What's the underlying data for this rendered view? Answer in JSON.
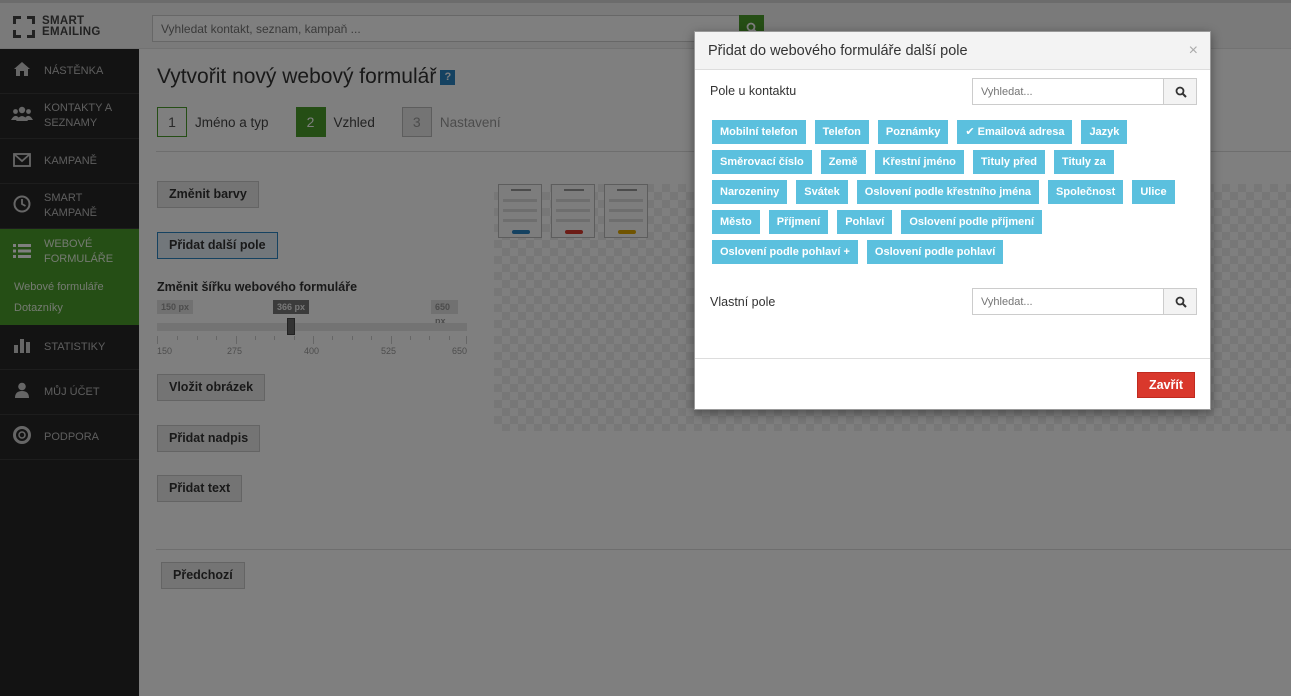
{
  "app": {
    "logo_line1": "SMART",
    "logo_line2": "EMAILING"
  },
  "top_search": {
    "placeholder": "Vyhledat kontakt, seznam, kampaň ..."
  },
  "sidebar": {
    "items": [
      {
        "label": "NÁSTĚNKA",
        "icon": "home-icon"
      },
      {
        "label": "KONTAKTY A SEZNAMY",
        "icon": "users-icon"
      },
      {
        "label": "KAMPANĚ",
        "icon": "envelope-icon"
      },
      {
        "label": "SMART KAMPANĚ",
        "icon": "clock-icon"
      },
      {
        "label": "WEBOVÉ FORMULÁŘE",
        "icon": "list-icon"
      },
      {
        "label": "STATISTIKY",
        "icon": "bar-chart-icon"
      },
      {
        "label": "MŮJ ÚČET",
        "icon": "user-icon"
      },
      {
        "label": "PODPORA",
        "icon": "lifebuoy-icon"
      }
    ],
    "sub_items": [
      "Webové formuláře",
      "Dotazníky"
    ]
  },
  "page": {
    "title": "Vytvořit nový webový formulář",
    "help": "?",
    "steps": [
      {
        "num": "1",
        "label": "Jméno a typ"
      },
      {
        "num": "2",
        "label": "Vzhled"
      },
      {
        "num": "3",
        "label": "Nastavení"
      }
    ],
    "buttons": {
      "change_colors": "Změnit barvy",
      "add_field": "Přidat další pole",
      "insert_image": "Vložit obrázek",
      "add_heading": "Přidat nadpis",
      "add_text": "Přidat text",
      "previous": "Předchozí"
    },
    "width_label": "Změnit šířku webového formuláře",
    "slider": {
      "min_label": "150 px",
      "current_label": "366 px",
      "max_label": "650 px",
      "min": 150,
      "max": 650,
      "value": 366,
      "tick_labels": [
        "150",
        "275",
        "400",
        "525",
        "650"
      ]
    }
  },
  "modal": {
    "title": "Přidat do webového formuláře další pole",
    "close": "×",
    "contact_fields_label": "Pole u kontaktu",
    "search_placeholder": "Vyhledat...",
    "tags": [
      "Mobilní telefon",
      "Telefon",
      "Poznámky",
      "✔ Emailová adresa",
      "Jazyk",
      "Směrovací číslo",
      "Země",
      "Křestní jméno",
      "Tituly před",
      "Tituly za",
      "Narozeniny",
      "Svátek",
      "Oslovení podle křestního jména",
      "Společnost",
      "Ulice",
      "Město",
      "Příjmení",
      "Pohlaví",
      "Oslovení podle příjmení",
      "Oslovení podle pohlaví +",
      "Oslovení podle pohlaví"
    ],
    "custom_fields_label": "Vlastní pole",
    "close_button": "Zavřít"
  }
}
